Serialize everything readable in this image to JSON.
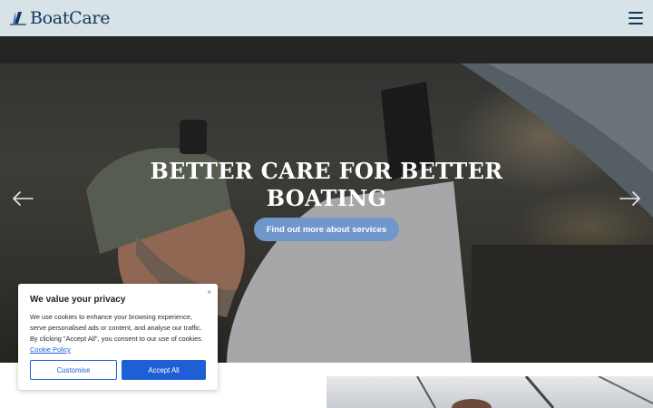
{
  "header": {
    "brand": "BoatCare",
    "logo_icon": "sail-mark-icon",
    "menu_icon": "hamburger-menu-icon",
    "brand_color": "#13355b",
    "background": "#d8e3e8"
  },
  "hero": {
    "title": "BETTER CARE FOR BETTER BOATING",
    "cta_label": "Find out more about services",
    "cta_color": "#6f97cc",
    "prev_icon": "arrow-left-icon",
    "next_icon": "arrow-right-icon"
  },
  "cookie_banner": {
    "title": "We value your privacy",
    "body": "We use cookies to enhance your browsing experience, serve personalised ads or content, and analyse our traffic. By clicking \"Accept All\", you consent to our use of cookies.",
    "link_text": "Cookie Policy",
    "close_glyph": "×",
    "customise_label": "Customise",
    "accept_label": "Accept All",
    "accent_color": "#1f5fd6"
  }
}
